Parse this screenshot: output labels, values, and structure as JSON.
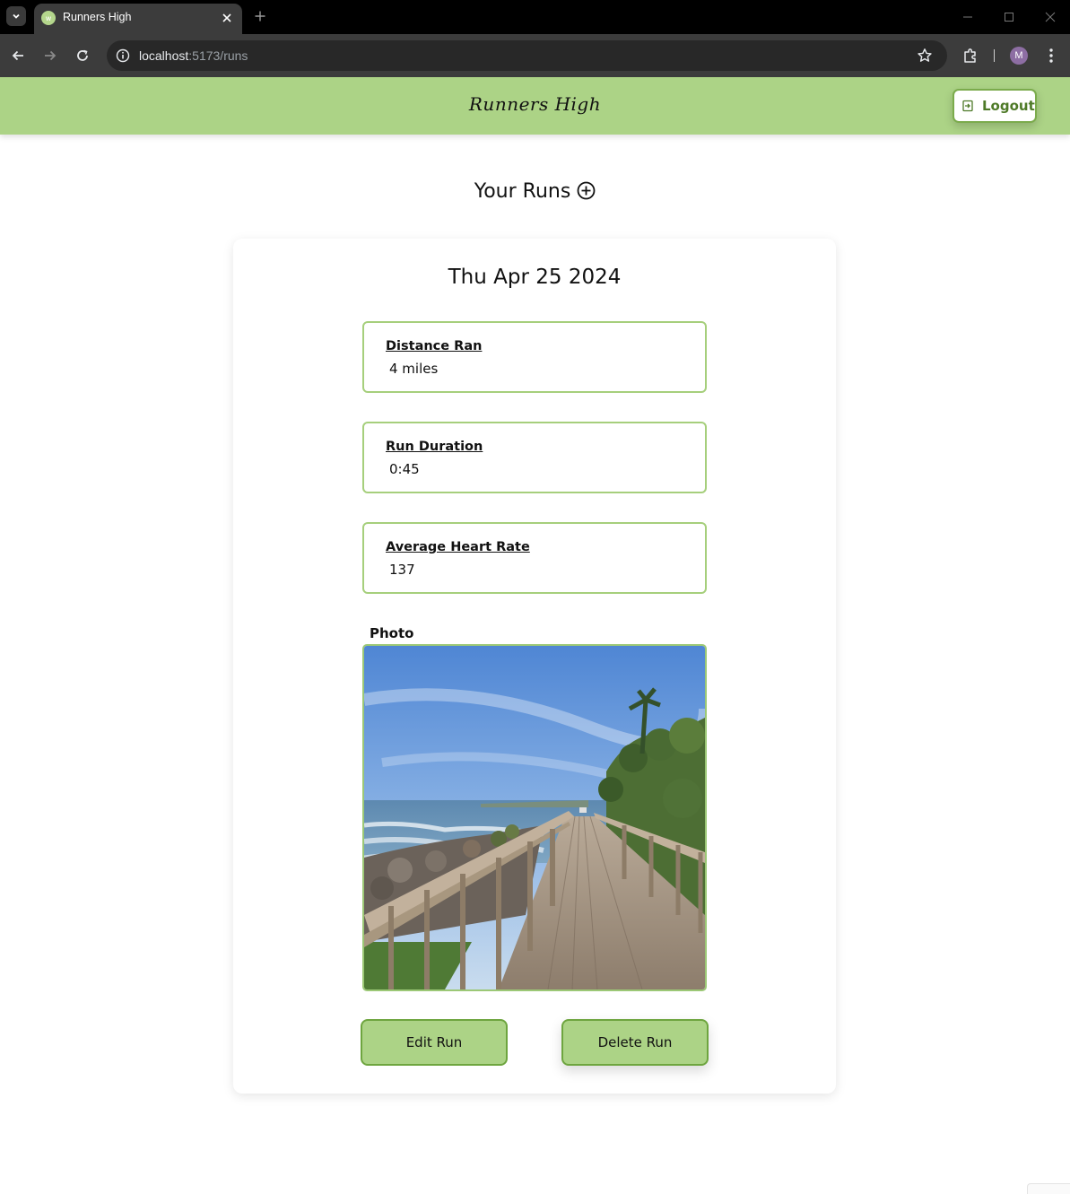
{
  "browser": {
    "tab_title": "Runners High",
    "url_host": "localhost",
    "url_rest": ":5173/runs",
    "profile_initial": "M",
    "favicon_text": "w"
  },
  "header": {
    "brand": "Runners High",
    "logout_label": "Logout",
    "background": "#acd386"
  },
  "page": {
    "title": "Your Runs"
  },
  "run": {
    "date": "Thu Apr 25 2024",
    "stats": [
      {
        "label": "Distance Ran",
        "value": "4 miles"
      },
      {
        "label": "Run Duration",
        "value": "0:45"
      },
      {
        "label": "Average Heart Rate",
        "value": "137"
      }
    ],
    "photo_label": "Photo",
    "edit_label": "Edit Run",
    "delete_label": "Delete Run"
  },
  "icons": {
    "add": "plus-circle-icon",
    "logout": "logout-icon",
    "star": "bookmark-star-icon",
    "extensions": "puzzle-icon"
  }
}
